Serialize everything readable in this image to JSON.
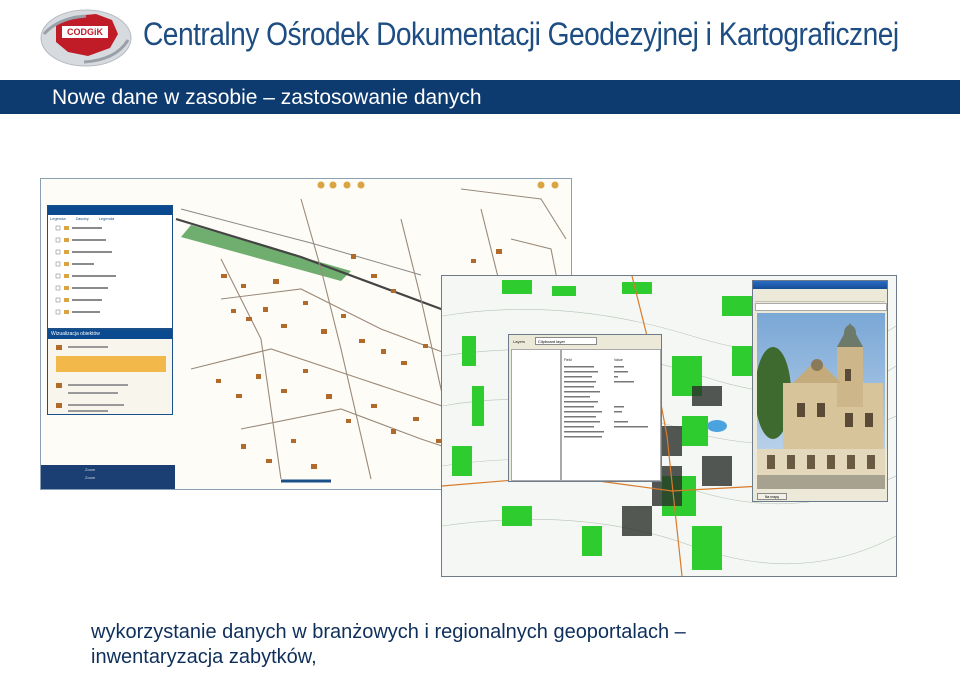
{
  "header": {
    "logo_text": "CODGiK",
    "org_name": "Centralny Ośrodek Dokumentacji Geodezyjnej i Kartograficznej"
  },
  "slide": {
    "title": "Nowe dane w zasobie – zastosowanie danych",
    "caption_line1": "wykorzystanie danych w branżowych i regionalnych geoportalach –",
    "caption_line2": "inwentaryzacja zabytków,"
  },
  "screenshot_a": {
    "legend_panel": {
      "tabs": [
        "Legenda",
        "Zasoby",
        "Legenda"
      ]
    },
    "lower_panel": {
      "title": "Wizualizacja obiektów"
    },
    "bottom_panel": {
      "items": [
        "Zoom",
        "Zoom"
      ]
    }
  },
  "screenshot_b": {
    "dialog": {
      "title": "Layers",
      "dropdown_value": "Clipboard layer",
      "column_headers": [
        "Field",
        "Value"
      ]
    },
    "browser": {
      "bottom_button": "Na mapę"
    }
  },
  "colors": {
    "brand_blue": "#1d4d82",
    "title_bar": "#0e3b6f",
    "caption": "#0e2f5b",
    "map_green": "#2ecc2e",
    "building_brown": "#b06a2a"
  }
}
